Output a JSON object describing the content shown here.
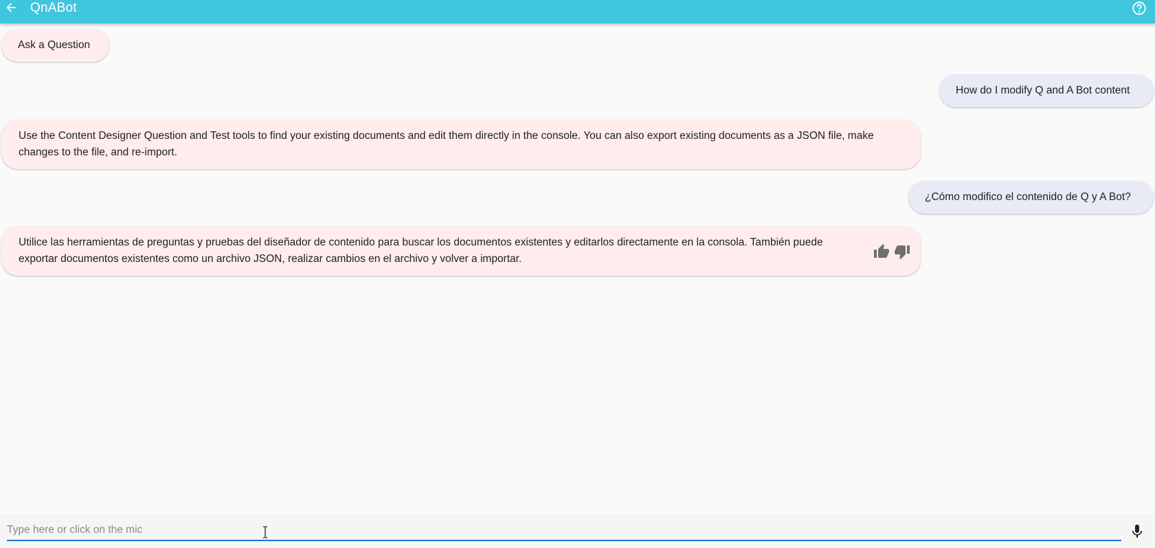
{
  "header": {
    "title": "QnABot",
    "back_icon": "arrow-left-icon",
    "help_icon": "help-circle-icon",
    "background_color": "#3fc5dc"
  },
  "messages": [
    {
      "from": "bot",
      "text": "Ask a Question"
    },
    {
      "from": "human",
      "text": "How do I modify Q and A Bot content"
    },
    {
      "from": "bot",
      "text": "Use the Content Designer Question and Test tools to find your existing documents and edit them directly in the console. You can also export existing documents as a JSON file, make changes to the file, and re-import."
    },
    {
      "from": "human",
      "text": "¿Cómo modifico el contenido de Q y A Bot?"
    },
    {
      "from": "bot",
      "text": "Utilice las herramientas de preguntas y pruebas del diseñador de contenido para buscar los documentos existentes y editarlos directamente en la consola. También puede exportar documentos existentes como un archivo JSON, realizar cambios en el archivo y volver a importar.",
      "feedback": {
        "thumbs_up_icon": "thumbs-up-icon",
        "thumbs_down_icon": "thumbs-down-icon"
      }
    }
  ],
  "input": {
    "placeholder": "Type here or click on the mic",
    "value": "",
    "mic_icon": "microphone-icon",
    "underline_color": "#1976d2"
  },
  "colors": {
    "bot_bubble": "#ffeded",
    "human_bubble": "#e8eaf6",
    "background": "#fafafa"
  }
}
